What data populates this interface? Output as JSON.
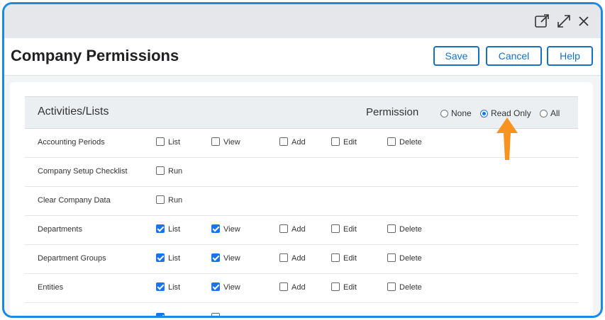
{
  "window": {
    "icons": [
      "open-external-icon",
      "expand-icon",
      "close-icon"
    ]
  },
  "header": {
    "title": "Company Permissions",
    "buttons": {
      "save": "Save",
      "cancel": "Cancel",
      "help": "Help"
    }
  },
  "table": {
    "header_left": "Activities/Lists",
    "permission_label": "Permission",
    "permission_options": [
      {
        "label": "None",
        "selected": false
      },
      {
        "label": "Read Only",
        "selected": true
      },
      {
        "label": "All",
        "selected": false
      }
    ],
    "rows": [
      {
        "label": "Accounting Periods",
        "options": [
          {
            "label": "List",
            "checked": false
          },
          {
            "label": "View",
            "checked": false
          },
          {
            "label": "Add",
            "checked": false
          },
          {
            "label": "Edit",
            "checked": false
          },
          {
            "label": "Delete",
            "checked": false
          }
        ]
      },
      {
        "label": "Company Setup Checklist",
        "options": [
          {
            "label": "Run",
            "checked": false
          }
        ]
      },
      {
        "label": "Clear Company Data",
        "options": [
          {
            "label": "Run",
            "checked": false
          }
        ]
      },
      {
        "label": "Departments",
        "options": [
          {
            "label": "List",
            "checked": true
          },
          {
            "label": "View",
            "checked": true
          },
          {
            "label": "Add",
            "checked": false
          },
          {
            "label": "Edit",
            "checked": false
          },
          {
            "label": "Delete",
            "checked": false
          }
        ]
      },
      {
        "label": "Department Groups",
        "options": [
          {
            "label": "List",
            "checked": true
          },
          {
            "label": "View",
            "checked": true
          },
          {
            "label": "Add",
            "checked": false
          },
          {
            "label": "Edit",
            "checked": false
          },
          {
            "label": "Delete",
            "checked": false
          }
        ]
      },
      {
        "label": "Entities",
        "options": [
          {
            "label": "List",
            "checked": true
          },
          {
            "label": "View",
            "checked": true
          },
          {
            "label": "Add",
            "checked": false
          },
          {
            "label": "Edit",
            "checked": false
          },
          {
            "label": "Delete",
            "checked": false
          }
        ]
      }
    ]
  },
  "colors": {
    "accent": "#1a73e8",
    "frame": "#1a8ae8",
    "annotation_arrow": "#f7931e"
  }
}
